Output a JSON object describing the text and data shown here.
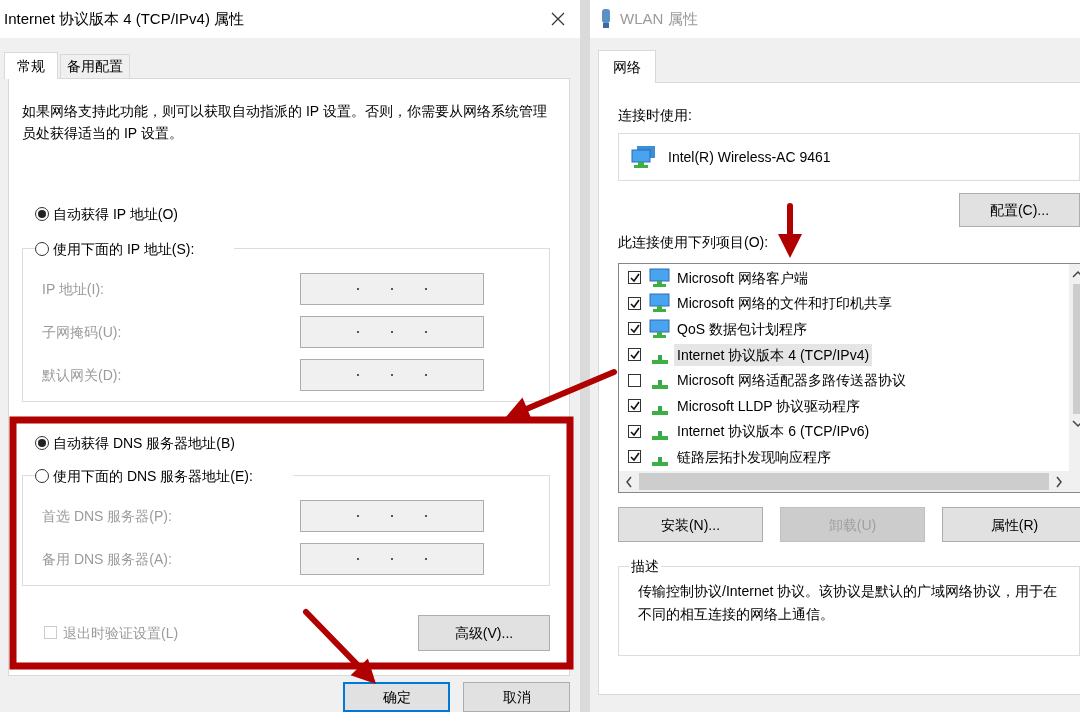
{
  "left_window": {
    "title": "Internet 协议版本 4 (TCP/IPv4) 属性",
    "tabs": [
      {
        "label": "常规",
        "selected": true
      },
      {
        "label": "备用配置",
        "selected": false
      }
    ],
    "intro": "如果网络支持此功能，则可以获取自动指派的 IP 设置。否则，你需要从网络系统管理员处获得适当的 IP 设置。",
    "ip_options": [
      {
        "label": "自动获得 IP 地址(O)",
        "selected": true
      },
      {
        "label": "使用下面的 IP 地址(S):",
        "selected": false
      }
    ],
    "ip_fields": [
      {
        "label": "IP 地址(I):",
        "disabled": true
      },
      {
        "label": "子网掩码(U):",
        "disabled": true
      },
      {
        "label": "默认网关(D):",
        "disabled": true
      }
    ],
    "dns_options": [
      {
        "label": "自动获得 DNS 服务器地址(B)",
        "selected": true
      },
      {
        "label": "使用下面的 DNS 服务器地址(E):",
        "selected": false
      }
    ],
    "dns_fields": [
      {
        "label": "首选 DNS 服务器(P):",
        "disabled": true
      },
      {
        "label": "备用 DNS 服务器(A):",
        "disabled": true
      }
    ],
    "validate_checkbox": {
      "label": "退出时验证设置(L)",
      "checked": false,
      "disabled": true
    },
    "advanced_button": "高级(V)...",
    "buttons": [
      {
        "label": "确定",
        "default": true
      },
      {
        "label": "取消",
        "default": false
      }
    ]
  },
  "right_window": {
    "title": "WLAN 属性",
    "tabs": [
      {
        "label": "网络",
        "selected": true
      }
    ],
    "connect_using_label": "连接时使用:",
    "adapter": "Intel(R) Wireless-AC 9461",
    "configure_button": "配置(C)...",
    "items_label": "此连接使用下列项目(O):",
    "items": [
      {
        "label": "Microsoft 网络客户端",
        "kind": "service",
        "checked": true,
        "selected": false
      },
      {
        "label": "Microsoft 网络的文件和打印机共享",
        "kind": "service",
        "checked": true,
        "selected": false
      },
      {
        "label": "QoS 数据包计划程序",
        "kind": "service",
        "checked": true,
        "selected": false
      },
      {
        "label": "Internet 协议版本 4 (TCP/IPv4)",
        "kind": "protocol",
        "checked": true,
        "selected": true
      },
      {
        "label": "Microsoft 网络适配器多路传送器协议",
        "kind": "protocol",
        "checked": false,
        "selected": false
      },
      {
        "label": "Microsoft LLDP 协议驱动程序",
        "kind": "protocol",
        "checked": true,
        "selected": false
      },
      {
        "label": "Internet 协议版本 6 (TCP/IPv6)",
        "kind": "protocol",
        "checked": true,
        "selected": false
      },
      {
        "label": "链路层拓扑发现响应程序",
        "kind": "protocol",
        "checked": true,
        "selected": false
      }
    ],
    "buttons": [
      {
        "label": "安装(N)...",
        "disabled": false
      },
      {
        "label": "卸载(U)",
        "disabled": true
      },
      {
        "label": "属性(R)",
        "disabled": false
      }
    ],
    "description": {
      "legend": "描述",
      "text": "传输控制协议/Internet 协议。该协议是默认的广域网络协议，用于在不同的相互连接的网络上通信。"
    }
  }
}
